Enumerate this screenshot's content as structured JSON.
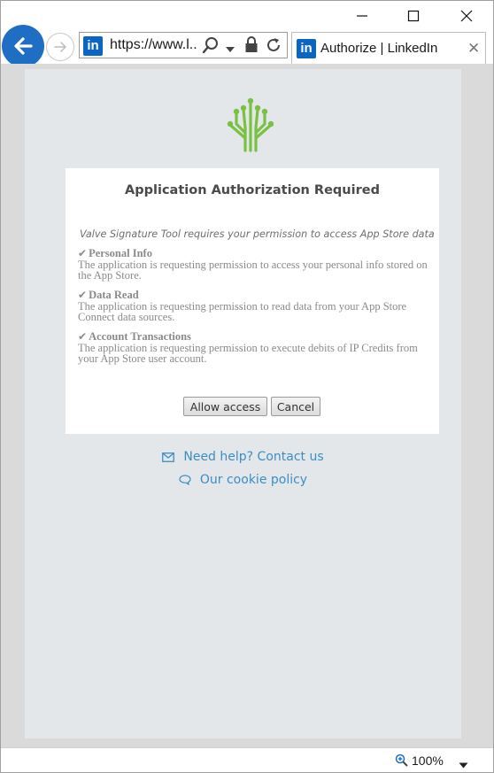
{
  "browser": {
    "address_url": "https://www.l...",
    "favicon_text": "in",
    "tab_title": "Authorize | LinkedIn",
    "tab_close": "✕",
    "zoom_level": "100%"
  },
  "icons": {
    "back": "back-arrow-icon",
    "forward": "forward-arrow-icon",
    "search": "search-icon",
    "dropdown": "chevron-down-icon",
    "lock": "lock-icon",
    "refresh": "refresh-icon",
    "minimize": "minimize-icon",
    "maximize": "maximize-icon",
    "close": "close-icon",
    "logo": "tree-logo-icon",
    "mail": "envelope-icon",
    "chat": "speech-bubble-icon",
    "zoom": "zoom-icon"
  },
  "colors": {
    "accent_blue": "#1e6fc3",
    "linkedin_blue": "#0a66c2",
    "logo_green": "#79c142",
    "link_blue": "#3a8ec4"
  },
  "dialog": {
    "title": "Application Authorization Required",
    "intro": "Valve Signature Tool requires your permission to access App Store data",
    "permissions": [
      {
        "name": "Personal Info",
        "description": "The application is requesting permission to access your personal info stored on the App Store."
      },
      {
        "name": "Data Read",
        "description": "The application is requesting permission to read data from your App Store Connect data sources."
      },
      {
        "name": "Account Transactions",
        "description": "The application is requesting permission to execute debits of IP Credits from your App Store user account."
      }
    ],
    "allow_label": "Allow access",
    "cancel_label": "Cancel"
  },
  "footer_links": {
    "help": "Need help? Contact us",
    "cookie": "Our cookie policy"
  }
}
